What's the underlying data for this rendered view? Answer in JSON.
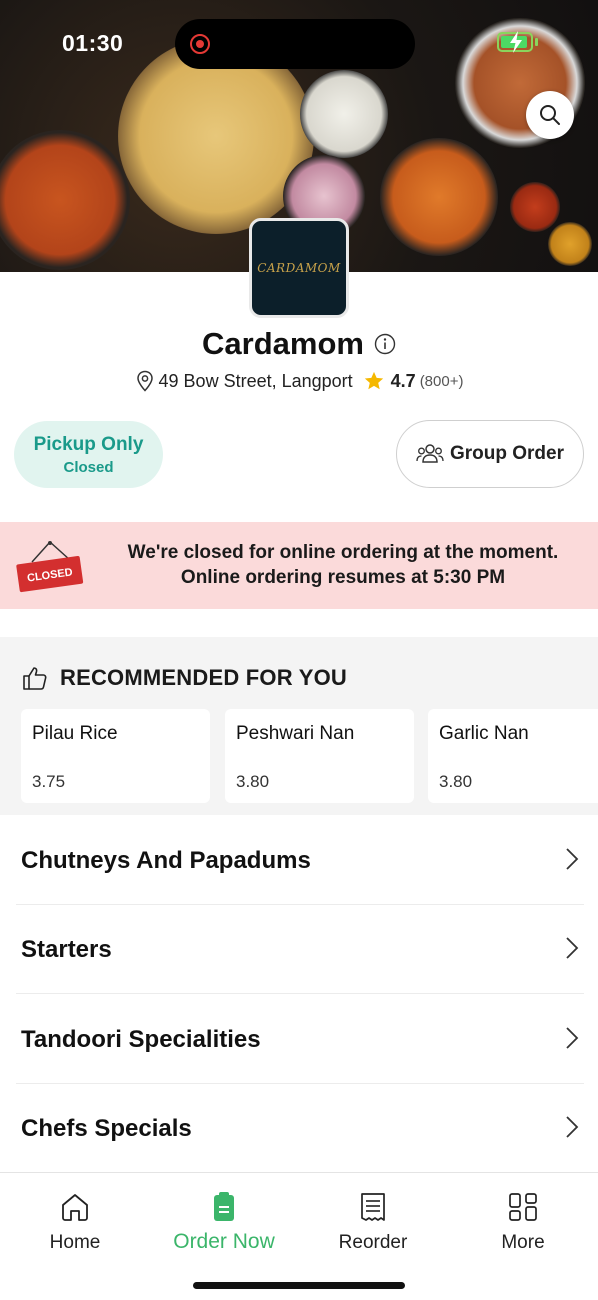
{
  "status_bar": {
    "time": "01:30"
  },
  "restaurant": {
    "name": "Cardamom",
    "logo_text": "CARDAMOM",
    "address": "49 Bow Street, Langport",
    "rating": "4.7",
    "rating_count": "(800+)"
  },
  "pickup": {
    "title": "Pickup Only",
    "status": "Closed"
  },
  "group_order": {
    "label": "Group Order"
  },
  "closed_banner": {
    "sign_text": "CLOSED",
    "line1": "We're closed for online ordering at the moment.",
    "line2": "Online ordering resumes at 5:30 PM"
  },
  "recommended": {
    "title": "RECOMMENDED FOR YOU",
    "items": [
      {
        "name": "Pilau Rice",
        "price": "3.75"
      },
      {
        "name": "Peshwari Nan",
        "price": "3.80"
      },
      {
        "name": "Garlic Nan",
        "price": "3.80"
      }
    ]
  },
  "categories": [
    {
      "label": "Chutneys And Papadums"
    },
    {
      "label": "Starters"
    },
    {
      "label": "Tandoori Specialities"
    },
    {
      "label": "Chefs Specials"
    }
  ],
  "nav": {
    "items": [
      {
        "label": "Home",
        "icon": "home-icon"
      },
      {
        "label": "Order Now",
        "icon": "order-icon"
      },
      {
        "label": "Reorder",
        "icon": "receipt-icon"
      },
      {
        "label": "More",
        "icon": "grid-icon"
      }
    ],
    "active_color": "#3bb56a"
  },
  "colors": {
    "accent_green": "#3bb56a",
    "pickup_teal": "#1a9a8a",
    "pickup_bg": "#e1f4ef",
    "closed_bg": "#fbdada",
    "closed_sign": "#d32f2f"
  }
}
